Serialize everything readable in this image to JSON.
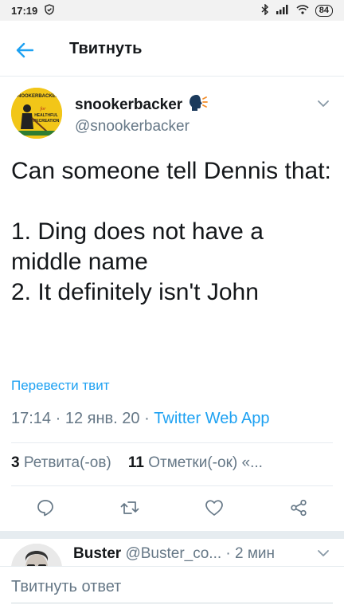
{
  "status_bar": {
    "time": "17:19",
    "battery": "84"
  },
  "topbar": {
    "title": "Твитнуть"
  },
  "author": {
    "name": "snookerbacker",
    "handle": "@snookerbacker",
    "verified_emoji": "speaking-head"
  },
  "avatar_text": {
    "line1": "SNOOKERBACKER",
    "line2": "for",
    "line3": "HEALTHFUL",
    "line4": "RECREATION"
  },
  "tweet": {
    "text": "Can someone tell Dennis that:\n\n1. Ding does not have a middle name\n2. It definitely isn't John",
    "translate_label": "Перевести твит",
    "time": "17:14",
    "date": "12 янв. 20",
    "source": "Twitter Web App"
  },
  "stats": {
    "retweets_count": "3",
    "retweets_label": "Ретвита(-ов)",
    "likes_count": "11",
    "likes_label": "Отметки(-ок) «..."
  },
  "actions": [
    "reply-icon",
    "retweet-icon",
    "like-icon",
    "share-icon"
  ],
  "reply": {
    "name": "Buster",
    "handle": "@Buster_co...",
    "time": "· 2 мин"
  },
  "composer": {
    "placeholder": "Твитнуть ответ"
  },
  "colors": {
    "accent": "#1da1f2",
    "secondary_text": "#657786"
  }
}
